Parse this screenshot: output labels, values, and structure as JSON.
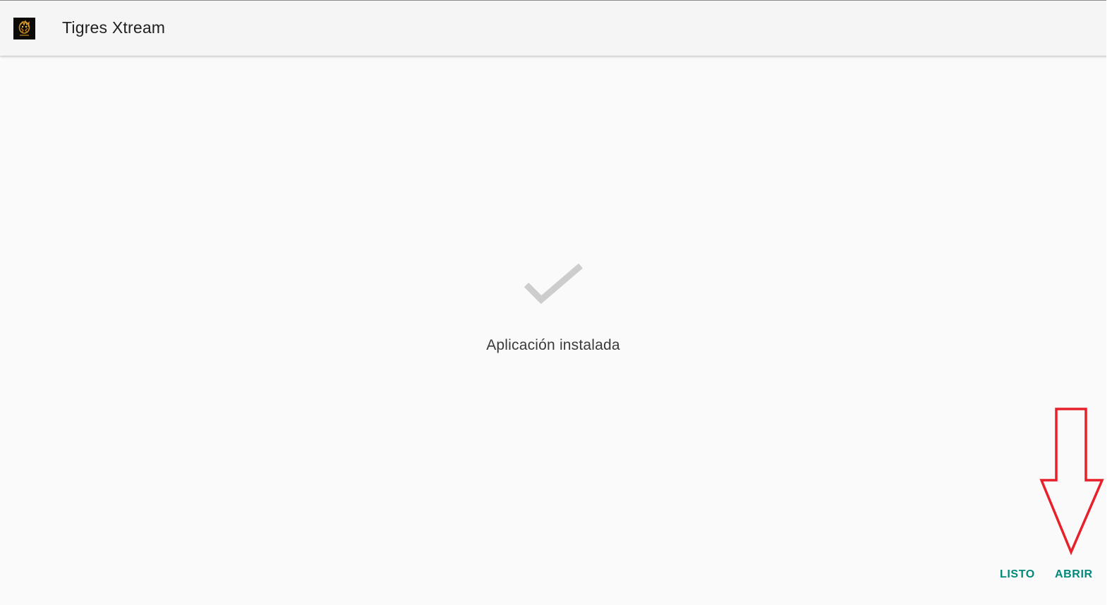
{
  "app_bar": {
    "title": "Tigres Xtream",
    "icon": "tiger-logo-icon",
    "background": "#f5f5f5"
  },
  "main": {
    "status_icon": "checkmark-icon",
    "status_text": "Aplicación instalada"
  },
  "actions": {
    "done_label": "LISTO",
    "open_label": "ABRIR",
    "accent_color": "#00897b"
  },
  "annotation": {
    "icon": "down-arrow-icon",
    "color": "#e8202a"
  }
}
